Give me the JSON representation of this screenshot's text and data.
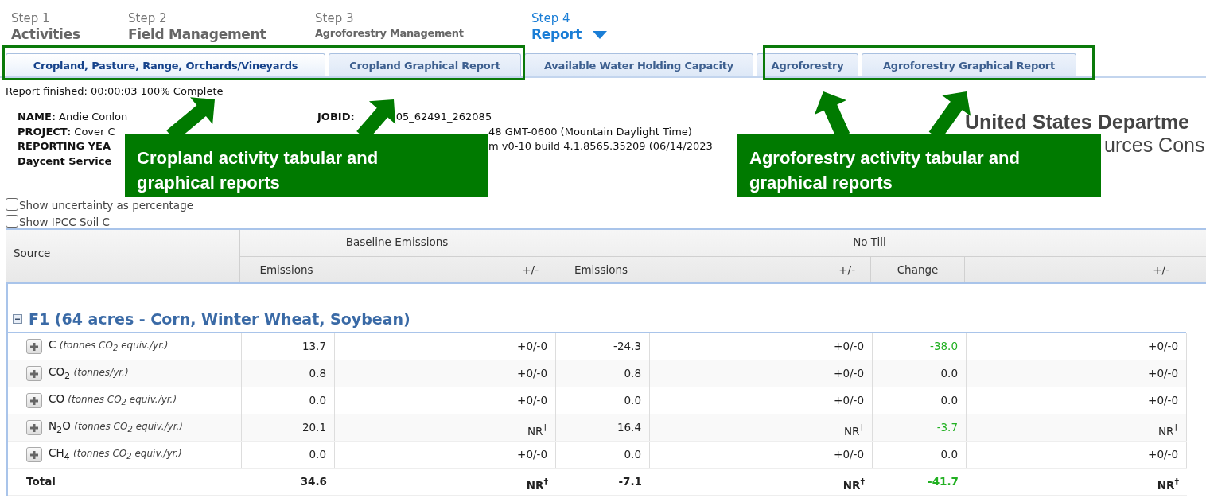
{
  "steps": [
    {
      "label": "Step 1",
      "title": "Activities",
      "selected": false,
      "compact": false
    },
    {
      "label": "Step 2",
      "title": "Field Management",
      "selected": false,
      "compact": false
    },
    {
      "label": "Step 3",
      "title": "Agroforestry Management",
      "selected": false,
      "compact": true
    },
    {
      "label": "Step 4",
      "title": "Report",
      "selected": true,
      "compact": false
    }
  ],
  "tabs": [
    {
      "label": "Cropland, Pasture, Range, Orchards/Vineyards",
      "selected": true
    },
    {
      "label": "Cropland Graphical Report",
      "selected": false
    },
    {
      "label": "Available Water Holding Capacity",
      "selected": false
    },
    {
      "label": "Agroforestry",
      "selected": false
    },
    {
      "label": "Agroforestry Graphical Report",
      "selected": false
    }
  ],
  "status": "Report finished: 00:00:03 100% Complete",
  "info_left": [
    {
      "label": "NAME:",
      "value": "Andie Conlon"
    },
    {
      "label": "PROJECT:",
      "value": "Cover C"
    },
    {
      "label": "REPORTING YEA"
    },
    {
      "label": "Daycent Service"
    }
  ],
  "info_right": [
    {
      "label": "JOBID:",
      "value": "05_62491_262085"
    },
    {
      "value": "48 GMT-0600 (Mountain Daylight Time)"
    },
    {
      "value": "m v0-10 build 4.1.8565.35209 (06/14/2023"
    }
  ],
  "agency": [
    "United States Departme",
    "urces Cons"
  ],
  "options": [
    {
      "label": "Show uncertainty as percentage",
      "checked": false
    },
    {
      "label": "Show IPCC Soil C",
      "checked": false
    }
  ],
  "table": {
    "groups": [
      "Baseline Emissions",
      "No Till"
    ],
    "source_header": "Source",
    "columns": [
      "Emissions",
      "+/-",
      "Emissions",
      "+/-",
      "Change",
      "+/-"
    ],
    "field": "F1 (64 acres - Corn, Winter Wheat, Soybean)",
    "rows": [
      {
        "gas": "C",
        "unit": "(tonnes CO$_{2}$ equiv./yr.)",
        "cells": [
          "13.7",
          "+0/-0",
          "-24.3",
          "+0/-0",
          "-38.0",
          "+0/-0"
        ],
        "change_reduced": true
      },
      {
        "gas": "CO$_{2}$",
        "unit": "(tonnes/yr.)",
        "cells": [
          "0.8",
          "+0/-0",
          "0.8",
          "+0/-0",
          "0.0",
          "+0/-0"
        ],
        "change_reduced": false
      },
      {
        "gas": "CO",
        "unit": "(tonnes CO$_{2}$ equiv./yr.)",
        "cells": [
          "0.0",
          "+0/-0",
          "0.0",
          "+0/-0",
          "0.0",
          "+0/-0"
        ],
        "change_reduced": false
      },
      {
        "gas": "N$_{2}$O",
        "unit": "(tonnes CO$_{2}$ equiv./yr.)",
        "cells": [
          "20.1",
          "NR$^{†}$",
          "16.4",
          "NR$^{†}$",
          "-3.7",
          "NR$^{†}$"
        ],
        "change_reduced": true
      },
      {
        "gas": "CH$_{4}$",
        "unit": "(tonnes CO$_{2}$ equiv./yr.)",
        "cells": [
          "0.0",
          "+0/-0",
          "0.0",
          "+0/-0",
          "0.0",
          "+0/-0"
        ],
        "change_reduced": false
      }
    ],
    "total": {
      "source": "Total",
      "cells": [
        "34.6",
        "NR$^{†}$",
        "-7.1",
        "NR$^{†}$",
        "-41.7",
        "NR$^{†}$"
      ],
      "change_reduced": true
    }
  },
  "annotations": [
    {
      "text": "Cropland activity tabular and graphical reports"
    },
    {
      "text": "Agroforestry activity tabular and graphical reports"
    }
  ]
}
